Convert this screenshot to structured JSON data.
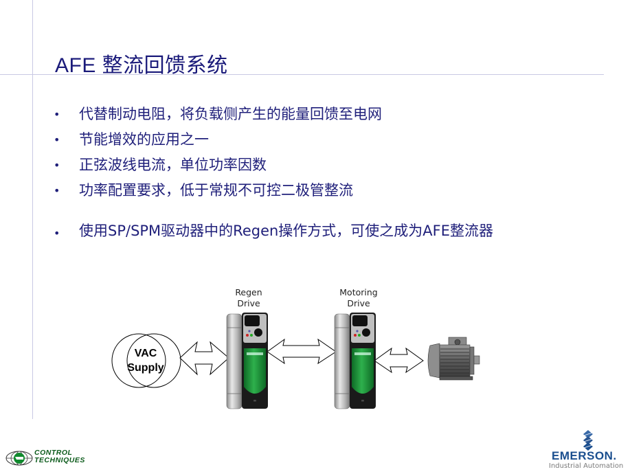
{
  "slide": {
    "title": "AFE 整流回馈系统",
    "bullets": [
      "代替制动电阻，将负载侧产生的能量回馈至电网",
      "节能增效的应用之一",
      "正弦波线电流，单位功率因数",
      "功率配置要求，低于常规不可控二极管整流",
      "使用SP/SPM驱动器中的Regen操作方式，可使之成为AFE整流器"
    ],
    "bullet_symbol": "•"
  },
  "diagram": {
    "supply_label_line1": "VAC",
    "supply_label_line2": "Supply",
    "regen_label_line1": "Regen",
    "regen_label_line2": "Drive",
    "motoring_label_line1": "Motoring",
    "motoring_label_line2": "Drive",
    "drive_accent_color": "#1e9a3c",
    "motor_color": "#6e6e6e"
  },
  "footer": {
    "left_logo_line1": "CONTROL",
    "left_logo_line2": "TECHNIQUES",
    "right_logo_name": "EMERSON.",
    "right_logo_sub": "Industrial Automation",
    "left_logo_color": "#0b5a1a",
    "right_logo_color": "#1b4f8f"
  }
}
